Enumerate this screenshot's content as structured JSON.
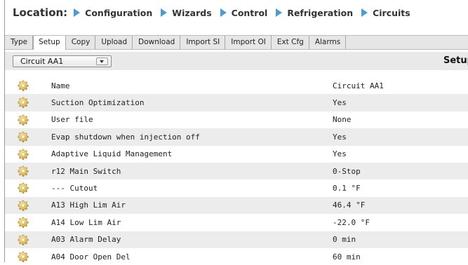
{
  "breadcrumb": {
    "label": "Location:",
    "items": [
      "Configuration",
      "Wizards",
      "Control",
      "Refrigeration",
      "Circuits"
    ]
  },
  "tabs": [
    {
      "label": "Type",
      "active": false
    },
    {
      "label": "Setup",
      "active": true
    },
    {
      "label": "Copy",
      "active": false
    },
    {
      "label": "Upload",
      "active": false
    },
    {
      "label": "Download",
      "active": false
    },
    {
      "label": "Import SI",
      "active": false
    },
    {
      "label": "Import OI",
      "active": false
    },
    {
      "label": "Ext Cfg",
      "active": false
    },
    {
      "label": "Alarms",
      "active": false
    }
  ],
  "circuit_select": {
    "value": "Circuit AA1"
  },
  "section_title": "Setup",
  "rows": [
    {
      "name": "Name",
      "value": "Circuit AA1"
    },
    {
      "name": "Suction Optimization",
      "value": "Yes"
    },
    {
      "name": "User file",
      "value": "None"
    },
    {
      "name": "Evap shutdown when injection off",
      "value": "Yes"
    },
    {
      "name": "Adaptive Liquid Management",
      "value": "Yes"
    },
    {
      "name": "r12 Main Switch",
      "value": "0-Stop"
    },
    {
      "name": "--- Cutout",
      "value": "0.1 °F"
    },
    {
      "name": "A13 High Lim Air",
      "value": "46.4 °F"
    },
    {
      "name": "A14 Low Lim Air",
      "value": "-22.0 °F"
    },
    {
      "name": "A03 Alarm Delay",
      "value": "0 min"
    },
    {
      "name": "A04 Door Open Del",
      "value": "60 min"
    }
  ],
  "colors": {
    "accent_arrow": "#4d9bd6",
    "row_alt": "#ececec"
  },
  "icons": {
    "row_icon": "gear-icon"
  }
}
